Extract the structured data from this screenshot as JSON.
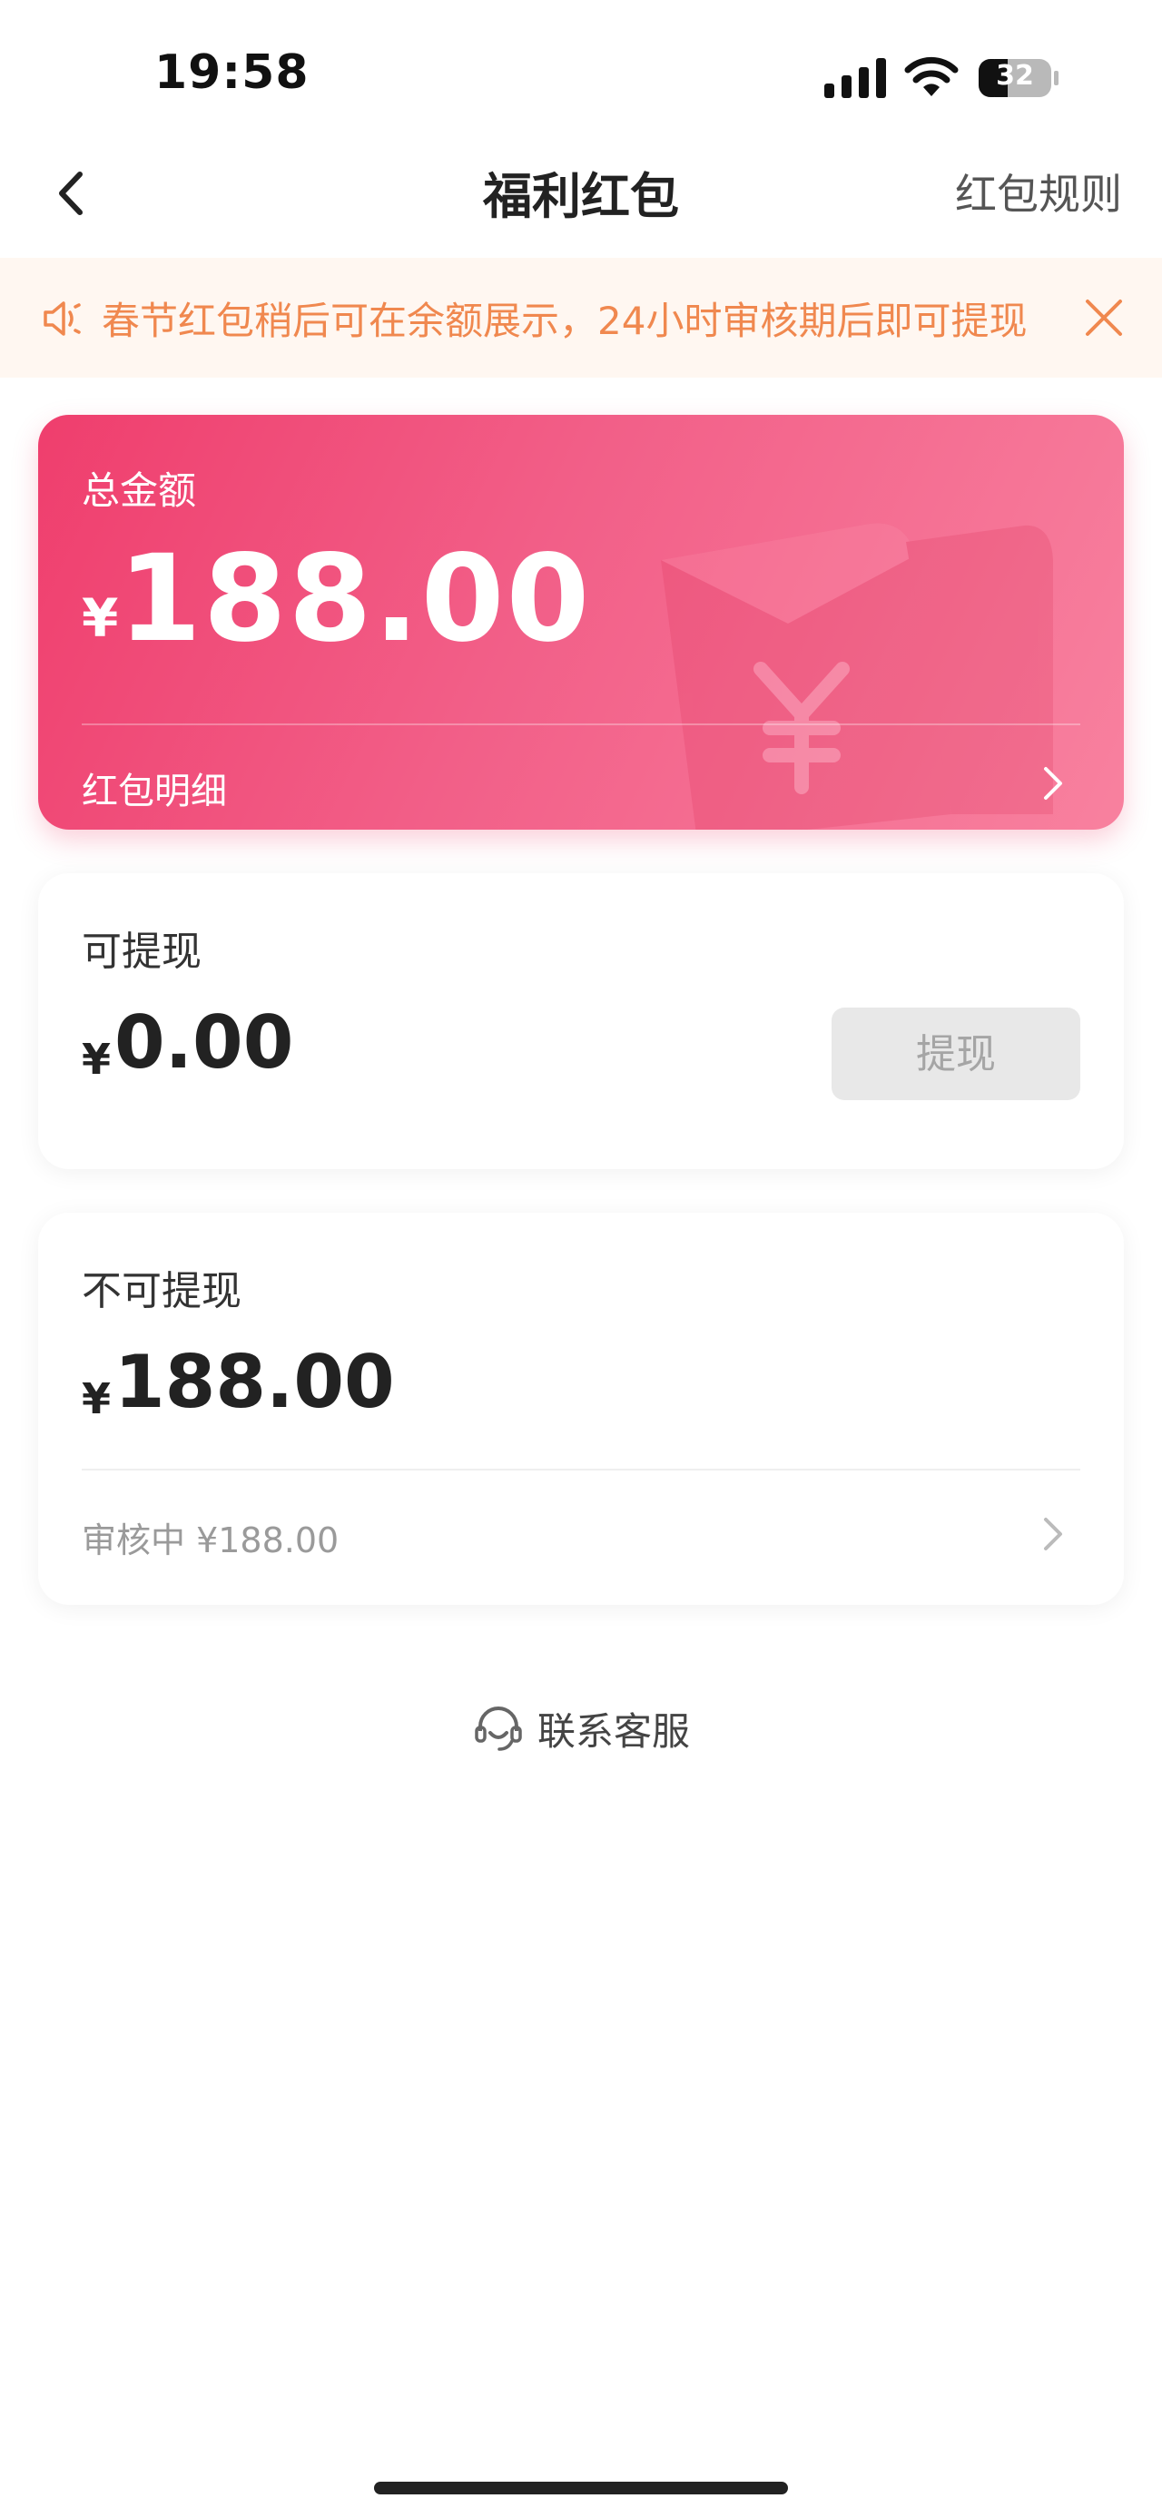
{
  "status_bar": {
    "time": "19:58",
    "battery": "32",
    "icons": [
      "signal-icon",
      "wifi-icon",
      "battery-icon"
    ]
  },
  "navbar": {
    "title": "福利红包",
    "rules_link": "红包规则",
    "back_icon": "chevron-left-icon"
  },
  "notice": {
    "text": "春节红包稍后可在余额展示，24小时审核期后即可提现",
    "icon": "speaker-icon",
    "close_icon": "close-icon",
    "color": "#f0884f"
  },
  "total_card": {
    "label": "总金额",
    "currency": "¥",
    "amount": "188.00",
    "detail_link": "红包明细",
    "colors": [
      "#ef3e6d",
      "#f8819f"
    ]
  },
  "withdrawable": {
    "label": "可提现",
    "currency": "¥",
    "amount": "0.00",
    "button": "提现"
  },
  "non_withdrawable": {
    "label": "不可提现",
    "currency": "¥",
    "amount": "188.00",
    "review_text": "审核中 ¥188.00"
  },
  "service": {
    "label": "联系客服",
    "icon": "headset-icon"
  }
}
